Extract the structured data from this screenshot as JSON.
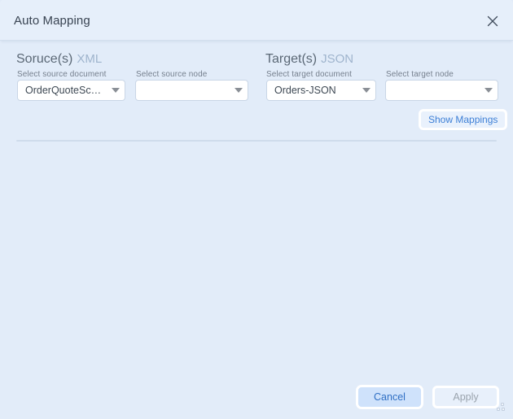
{
  "window": {
    "title": "Auto Mapping",
    "close_icon": "close-icon"
  },
  "source_panel": {
    "heading": "Soruce(s)",
    "format": "XML",
    "document_label": "Select source document",
    "document_value": "OrderQuoteSche…",
    "node_label": "Select source node",
    "node_value": ""
  },
  "target_panel": {
    "heading": "Target(s)",
    "format": "JSON",
    "document_label": "Select target document",
    "document_value": "Orders-JSON",
    "node_label": "Select target node",
    "node_value": ""
  },
  "actions": {
    "show_mappings": "Show Mappings",
    "cancel": "Cancel",
    "apply": "Apply"
  },
  "colors": {
    "dialog_background": "#e2ecf9",
    "titlebar_background": "#e6effa",
    "accent_link": "#3d7fd6",
    "cancel_fill": "#cfe2fb",
    "cancel_text": "#2f6fc4",
    "apply_text_disabled": "#9aa3ad",
    "format_label": "#9fb4cd",
    "divider": "#cfdcec"
  }
}
